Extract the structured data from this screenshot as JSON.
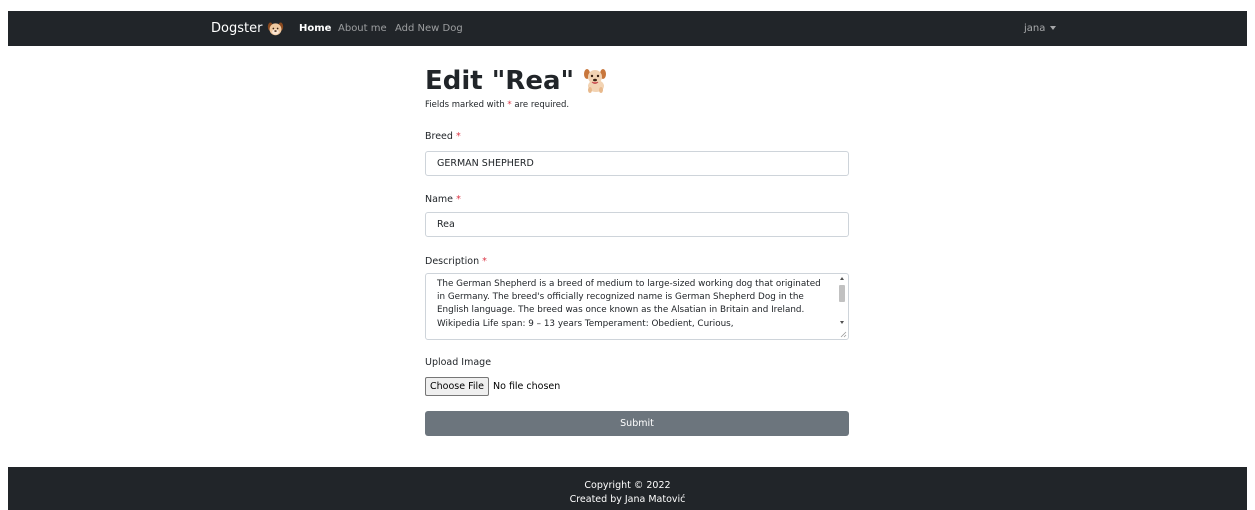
{
  "navbar": {
    "brand": "Dogster",
    "links": [
      {
        "label": "Home",
        "active": true
      },
      {
        "label": "About me",
        "active": false
      },
      {
        "label": "Add New Dog",
        "active": false
      }
    ],
    "user": "jana"
  },
  "page": {
    "title": "Edit \"Rea\"",
    "hint_prefix": "Fields marked with ",
    "hint_star": "*",
    "hint_suffix": " are required."
  },
  "form": {
    "breed": {
      "label": "Breed",
      "required_mark": "*",
      "value": "GERMAN SHEPHERD"
    },
    "name": {
      "label": "Name",
      "required_mark": "*",
      "value": "Rea"
    },
    "description": {
      "label": "Description",
      "required_mark": "*",
      "value": "The German Shepherd is a breed of medium to large-sized working dog that originated in Germany. The breed's officially recognized name is German Shepherd Dog in the English language. The breed was once known as the Alsatian in Britain and Ireland. Wikipedia Life span: 9 – 13 years Temperament: Obedient, Curious,"
    },
    "upload": {
      "label": "Upload Image",
      "button": "Choose File",
      "status": "No file chosen"
    },
    "submit": "Submit"
  },
  "footer": {
    "copyright": "Copyright © 2022",
    "credit": "Created by Jana Matović"
  },
  "colors": {
    "navbar_bg": "#212529",
    "required": "#dc3545",
    "submit_bg": "#6c757d"
  },
  "icons": {
    "brand": "dog-face-icon",
    "title": "dog-icon"
  }
}
